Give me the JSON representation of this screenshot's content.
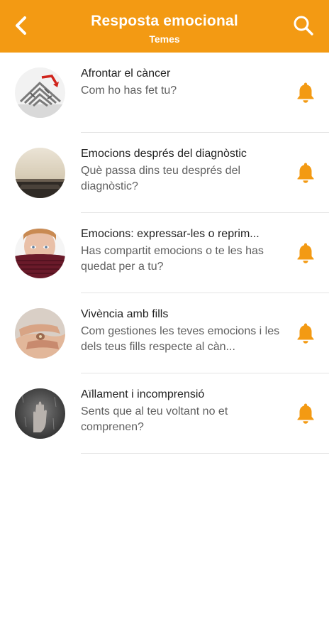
{
  "header": {
    "title": "Resposta emocional",
    "subtitle": "Temes",
    "back_icon": "chevron-left-icon",
    "search_icon": "search-icon"
  },
  "colors": {
    "accent": "#f39a13",
    "title_text": "#222222",
    "subtitle_text": "#5f5f5f",
    "divider": "#e4e4e4"
  },
  "topics": [
    {
      "title": "Afrontar el càncer",
      "subtitle": "Com ho has fet tu?",
      "icon": "bell-icon"
    },
    {
      "title": "Emocions després del diagnòstic",
      "subtitle": "Què passa dins teu després del diagnòstic?",
      "icon": "bell-icon"
    },
    {
      "title": "Emocions: expressar-les o reprim...",
      "subtitle": "Has compartit emocions o te les has quedat per a tu?",
      "icon": "bell-icon"
    },
    {
      "title": "Vivència amb fills",
      "subtitle": "Com gestiones les teves emocions i les dels teus fills respecte al càn...",
      "icon": "bell-icon"
    },
    {
      "title": "Aïllament i incomprensió",
      "subtitle": "Sents que al teu voltant no et comprenen?",
      "icon": "bell-icon"
    }
  ]
}
